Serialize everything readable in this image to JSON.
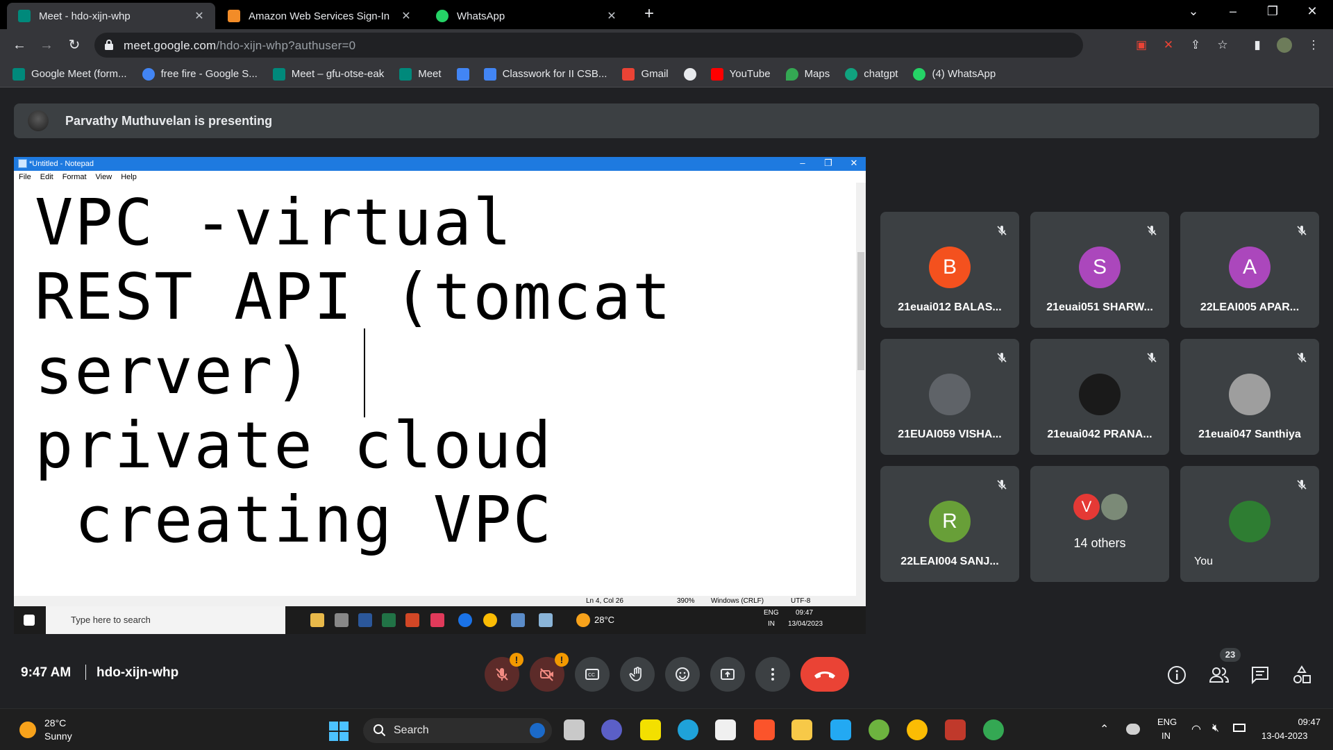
{
  "browser": {
    "tabs": [
      {
        "title": "Meet - hdo-xijn-whp",
        "favicon_color": "#00897b",
        "active": true
      },
      {
        "title": "Amazon Web Services Sign-In",
        "favicon_color": "#f28c28",
        "active": false
      },
      {
        "title": "WhatsApp",
        "favicon_color": "#25d366",
        "active": false
      }
    ],
    "url_host": "meet.google.com",
    "url_path": "/hdo-xijn-whp?authuser=0",
    "bookmarks": [
      {
        "label": "Google Meet (form...",
        "color": "#00897b"
      },
      {
        "label": "free fire - Google S...",
        "color": "#4285f4"
      },
      {
        "label": "Meet – gfu-otse-eak",
        "color": "#00897b"
      },
      {
        "label": "Meet",
        "color": "#00897b"
      },
      {
        "label": "",
        "color": "#4285f4"
      },
      {
        "label": "Classwork for II CSB...",
        "color": "#4285f4"
      },
      {
        "label": "Gmail",
        "color": "#ea4335"
      },
      {
        "label": "",
        "color": "#e8eaed"
      },
      {
        "label": "YouTube",
        "color": "#ff0000"
      },
      {
        "label": "Maps",
        "color": "#34a853"
      },
      {
        "label": "chatgpt",
        "color": "#10a37f"
      },
      {
        "label": "(4) WhatsApp",
        "color": "#25d366"
      }
    ]
  },
  "meet": {
    "presenting_text": "Parvathy Muthuvelan is presenting",
    "time": "9:47 AM",
    "meeting_code": "hdo-xijn-whp",
    "people_count": "23",
    "participants": [
      {
        "name": "21euai012 BALAS...",
        "initial": "B",
        "avatar_color": "#f4511e",
        "muted": true
      },
      {
        "name": "21euai051 SHARW...",
        "initial": "S",
        "avatar_color": "#ab47bc",
        "muted": true
      },
      {
        "name": "22LEAI005 APAR...",
        "initial": "A",
        "avatar_color": "#ab47bc",
        "muted": true
      },
      {
        "name": "21EUAI059 VISHA...",
        "initial": "",
        "avatar_color": "#5f6368",
        "muted": true
      },
      {
        "name": "21euai042 PRANA...",
        "initial": "",
        "avatar_color": "#1a1a1a",
        "muted": true
      },
      {
        "name": "21euai047 Santhiya",
        "initial": "",
        "avatar_color": "#9e9e9e",
        "muted": true
      },
      {
        "name": "22LEAI004 SANJ...",
        "initial": "R",
        "avatar_color": "#689f38",
        "muted": true
      },
      {
        "name": "14 others",
        "initial": "V",
        "avatar_color": "#e53935",
        "muted": false
      },
      {
        "name": "You",
        "initial": "",
        "avatar_color": "#2e7d32",
        "muted": true
      }
    ]
  },
  "notepad": {
    "title": "*Untitled - Notepad",
    "menu": [
      "File",
      "Edit",
      "Format",
      "View",
      "Help"
    ],
    "lines": [
      "VPC -virtual",
      "REST API (tomcat",
      "server) ",
      "private cloud",
      " creating VPC"
    ],
    "status": {
      "position": "Ln 4, Col 26",
      "zoom": "390%",
      "eol": "Windows (CRLF)",
      "encoding": "UTF-8"
    },
    "remote_search": "Type here to search",
    "remote_temp": "28°C",
    "remote_lang1": "ENG",
    "remote_lang2": "IN",
    "remote_time": "09:47",
    "remote_date": "13/04/2023"
  },
  "taskbar": {
    "temperature": "28°C",
    "condition": "Sunny",
    "search_label": "Search",
    "lang1": "ENG",
    "lang2": "IN",
    "time": "09:47",
    "date": "13-04-2023"
  }
}
